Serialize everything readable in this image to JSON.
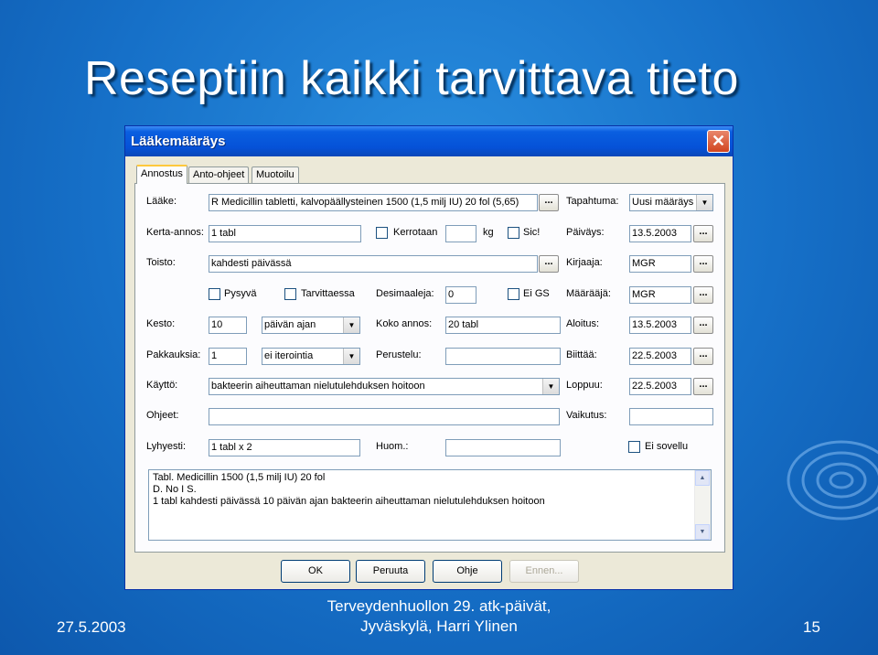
{
  "slide": {
    "title": "Reseptiin kaikki tarvittava tieto",
    "footer_date": "27.5.2003",
    "footer_center_line1": "Terveydenhuollon 29. atk-päivät,",
    "footer_center_line2": "Jyväskylä, Harri Ylinen",
    "page_number": "15"
  },
  "dialog": {
    "title": "Lääkemääräys",
    "close_icon": "close-icon",
    "tabs": [
      {
        "label": "Annostus",
        "active": true
      },
      {
        "label": "Anto-ohjeet",
        "active": false
      },
      {
        "label": "Muotoilu",
        "active": false
      }
    ],
    "fields": {
      "laake_label": "Lääke:",
      "laake_value": "R  Medicillin tabletti, kalvopäällysteinen 1500 (1,5 milj IU)  20 fol  (5,65)",
      "kerta_label": "Kerta-annos:",
      "kerta_value": "1 tabl",
      "kerrotaan_label": "Kerrotaan",
      "kg_label": "kg",
      "sic_label": "Sic!",
      "toisto_label": "Toisto:",
      "toisto_value": "kahdesti päivässä",
      "pysyva_label": "Pysyvä",
      "tarvittaessa_label": "Tarvittaessa",
      "desimaaleja_label": "Desimaaleja:",
      "desimaaleja_value": "0",
      "eigs_label": "Ei GS",
      "kesto_label": "Kesto:",
      "kesto_value": "10",
      "kesto_unit": "päivän ajan",
      "koko_label": "Koko annos:",
      "koko_value": "20 tabl",
      "pakkauksia_label": "Pakkauksia:",
      "pakkauksia_value": "1",
      "iterointi_value": "ei iterointia",
      "perustelu_label": "Perustelu:",
      "perustelu_value": "",
      "kaytto_label": "Käyttö:",
      "kaytto_value": "bakteerin aiheuttaman nielutulehduksen hoitoon",
      "ohjeet_label": "Ohjeet:",
      "ohjeet_value": "",
      "lyhyesti_label": "Lyhyesti:",
      "lyhyesti_value": "1 tabl x 2",
      "huom_label": "Huom.:",
      "huom_value": "",
      "tapahtuma_label": "Tapahtuma:",
      "tapahtuma_value": "Uusi määräys",
      "paivays_label": "Päiväys:",
      "paivays_value": "13.5.2003",
      "kirjaaja_label": "Kirjaaja:",
      "kirjaaja_value": "MGR",
      "maaraaja_label": "Määrääjä:",
      "maaraaja_value": "MGR",
      "aloitus_label": "Aloitus:",
      "aloitus_value": "13.5.2003",
      "bitti_label": "Biittää:",
      "bitti_value": "22.5.2003",
      "loppuu_label": "Loppuu:",
      "loppuu_value": "22.5.2003",
      "vaikutus_label": "Vaikutus:",
      "vaikutus_value": "",
      "eisovellu_label": "Ei sovellu"
    },
    "dots_label": "...",
    "memo_lines": [
      "Tabl. Medicillin 1500 (1,5 milj IU) 20 fol",
      "D. No I S.",
      "1 tabl kahdesti päivässä 10 päivän ajan bakteerin aiheuttaman nielutulehduksen hoitoon"
    ],
    "buttons": {
      "ok": "OK",
      "peruuta": "Peruuta",
      "ohje": "Ohje",
      "ennen": "Ennen..."
    }
  }
}
